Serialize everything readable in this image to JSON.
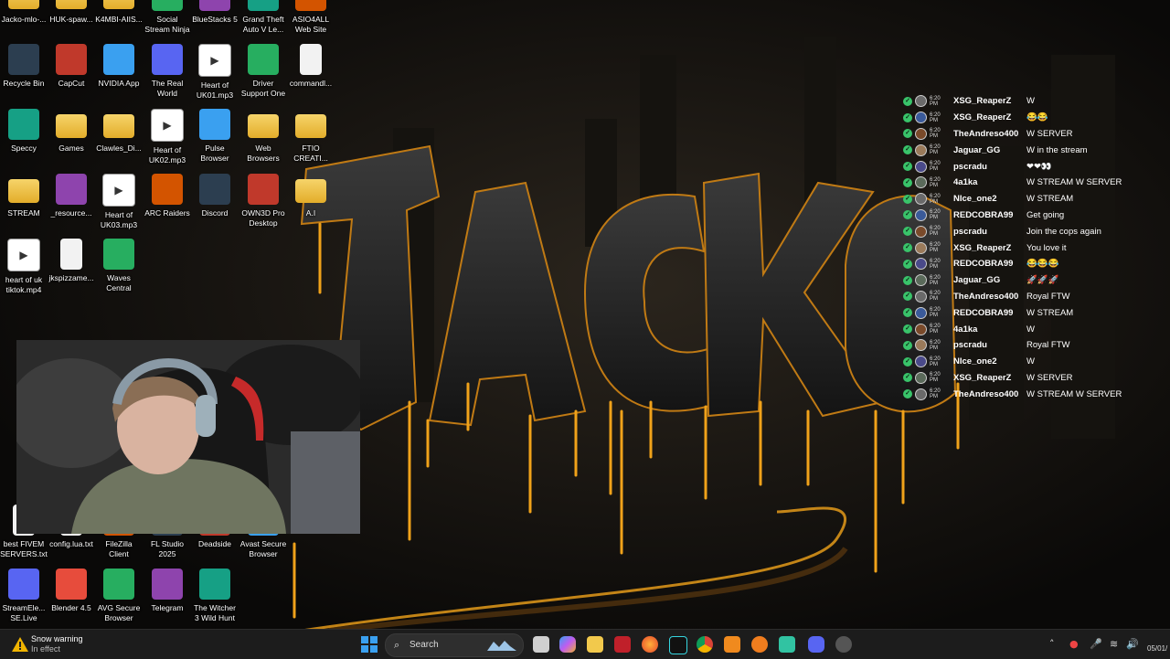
{
  "desktop": {
    "icons": [
      {
        "label": "Jacko-mlo-...",
        "type": "folder"
      },
      {
        "label": "HUK-spaw...",
        "type": "folder"
      },
      {
        "label": "K4MBI-AIIS...",
        "type": "folder"
      },
      {
        "label": "Social Stream Ninja",
        "type": "app"
      },
      {
        "label": "BlueStacks 5",
        "type": "app"
      },
      {
        "label": "Grand Theft Auto V Le...",
        "type": "app"
      },
      {
        "label": "ASIO4ALL Web Site",
        "type": "app"
      },
      {
        "label": "Recycle Bin",
        "type": "app"
      },
      {
        "label": "CapCut",
        "type": "app"
      },
      {
        "label": "NVIDIA App",
        "type": "app"
      },
      {
        "label": "The Real World",
        "type": "app"
      },
      {
        "label": "Heart of UK01.mp3",
        "type": "media"
      },
      {
        "label": "Driver Support One",
        "type": "app"
      },
      {
        "label": "commandl...",
        "type": "file"
      },
      {
        "label": "Speccy",
        "type": "app"
      },
      {
        "label": "Games",
        "type": "folder"
      },
      {
        "label": "Clawles_Di...",
        "type": "folder"
      },
      {
        "label": "Heart of UK02.mp3",
        "type": "media"
      },
      {
        "label": "Pulse Browser",
        "type": "app"
      },
      {
        "label": "Web Browsers",
        "type": "folder"
      },
      {
        "label": "FTIO CREATI...",
        "type": "folder"
      },
      {
        "label": "STREAM",
        "type": "folder"
      },
      {
        "label": "_resource...",
        "type": "app"
      },
      {
        "label": "Heart of UK03.mp3",
        "type": "media"
      },
      {
        "label": "ARC Raiders",
        "type": "app"
      },
      {
        "label": "Discord",
        "type": "app"
      },
      {
        "label": "OWN3D Pro Desktop",
        "type": "app"
      },
      {
        "label": "A.I",
        "type": "folder"
      },
      {
        "label": "heart of uk tiktok.mp4",
        "type": "media"
      },
      {
        "label": "jkspizzame...",
        "type": "file"
      },
      {
        "label": "Waves Central",
        "type": "app"
      },
      {
        "label": "best FIVEM SERVERS.txt",
        "type": "file"
      },
      {
        "label": "config.lua.txt",
        "type": "file"
      },
      {
        "label": "FileZilla Client",
        "type": "app"
      },
      {
        "label": "FL Studio 2025",
        "type": "app"
      },
      {
        "label": "Deadside",
        "type": "app"
      },
      {
        "label": "Avast Secure Browser",
        "type": "app"
      },
      {
        "label": "StreamEle... SE.Live",
        "type": "app"
      },
      {
        "label": "Blender 4.5",
        "type": "app"
      },
      {
        "label": "AVG Secure Browser",
        "type": "app"
      },
      {
        "label": "Telegram",
        "type": "app"
      },
      {
        "label": "The Witcher 3 Wild Hunt",
        "type": "app"
      }
    ]
  },
  "chat": {
    "time": "6:20 PM",
    "messages": [
      {
        "user": "XSG_ReaperZ",
        "text": "W"
      },
      {
        "user": "XSG_ReaperZ",
        "text": "😂😂"
      },
      {
        "user": "TheAndreso400",
        "text": "W SERVER"
      },
      {
        "user": "Jaguar_GG",
        "text": "W in the stream"
      },
      {
        "user": "pscradu",
        "text": "❤❤👀"
      },
      {
        "user": "4a1ka",
        "text": "W STREAM W SERVER"
      },
      {
        "user": "NIce_one2",
        "text": "W STREAM"
      },
      {
        "user": "REDCOBRA99",
        "text": "Get going"
      },
      {
        "user": "pscradu",
        "text": "Join the cops again"
      },
      {
        "user": "XSG_ReaperZ",
        "text": "You love it"
      },
      {
        "user": "REDCOBRA99",
        "text": "😂😂😂"
      },
      {
        "user": "Jaguar_GG",
        "text": "🚀🚀🚀"
      },
      {
        "user": "TheAndreso400",
        "text": "Royal FTW"
      },
      {
        "user": "REDCOBRA99",
        "text": "W STREAM"
      },
      {
        "user": "4a1ka",
        "text": "W"
      },
      {
        "user": "pscradu",
        "text": "Royal FTW"
      },
      {
        "user": "NIce_one2",
        "text": "W"
      },
      {
        "user": "XSG_ReaperZ",
        "text": "W SERVER"
      },
      {
        "user": "TheAndreso400",
        "text": "W STREAM W SERVER"
      }
    ]
  },
  "taskbar": {
    "weather_title": "Snow warning",
    "weather_subtitle": "In effect",
    "search_placeholder": "Search",
    "date_partial": "05/01/"
  },
  "colors": {
    "accent_drip": "#f0a21a",
    "check_green": "#39c46a",
    "taskbar_bg": "#1c1c1c"
  }
}
